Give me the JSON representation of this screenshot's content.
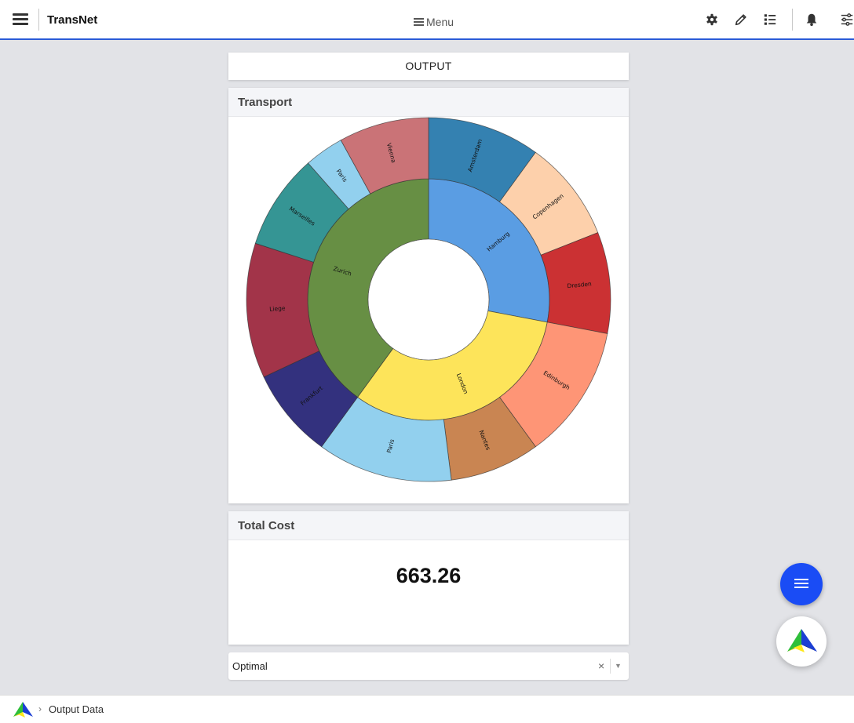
{
  "header": {
    "app_title": "TransNet",
    "menu_label": "Menu",
    "icons": [
      "menu-icon",
      "settings-icon",
      "pencil-icon",
      "list-icon",
      "bell-icon",
      "sliders-icon"
    ]
  },
  "output_label": "OUTPUT",
  "transport": {
    "title": "Transport"
  },
  "total_cost": {
    "title": "Total Cost",
    "value": "663.26"
  },
  "status_select": {
    "value": "Optimal",
    "clear_symbol": "×",
    "arrow_symbol": "▼"
  },
  "footer": {
    "breadcrumb_separator": "›",
    "breadcrumb": "Output Data"
  },
  "chart_data": {
    "type": "sunburst",
    "center_label": "",
    "rings": [
      {
        "name": "inner",
        "segments": [
          {
            "label": "Hamburg",
            "value": 28,
            "color": "#5a9de3"
          },
          {
            "label": "London",
            "value": 32,
            "color": "#fde45a"
          },
          {
            "label": "Zurich",
            "value": 40,
            "color": "#678f44"
          }
        ]
      },
      {
        "name": "outer",
        "segments": [
          {
            "label": "Amsterdam",
            "value": 10,
            "parent": "Hamburg",
            "color": "#3481b1"
          },
          {
            "label": "Copenhagen",
            "value": 9,
            "parent": "Hamburg",
            "color": "#fdd0ab"
          },
          {
            "label": "Dresden",
            "value": 9,
            "parent": "Hamburg",
            "color": "#cb3133"
          },
          {
            "label": "Edinburgh",
            "value": 12,
            "parent": "London",
            "color": "#fe9576"
          },
          {
            "label": "Nantes",
            "value": 8,
            "parent": "London",
            "color": "#c98552"
          },
          {
            "label": "Paris",
            "value": 12,
            "parent": "London",
            "color": "#92d0ee"
          },
          {
            "label": "Frankfurt",
            "value": 8,
            "parent": "Zurich",
            "color": "#33317e"
          },
          {
            "label": "Liege",
            "value": 12,
            "parent": "Zurich",
            "color": "#a23449"
          },
          {
            "label": "Marseilles",
            "value": 8.5,
            "parent": "Zurich",
            "color": "#359594"
          },
          {
            "label": "Paris",
            "value": 3.5,
            "parent": "Zurich",
            "color": "#92d0ee"
          },
          {
            "label": "Vienna",
            "value": 8,
            "parent": "Zurich",
            "color": "#ca7377"
          }
        ]
      }
    ]
  }
}
